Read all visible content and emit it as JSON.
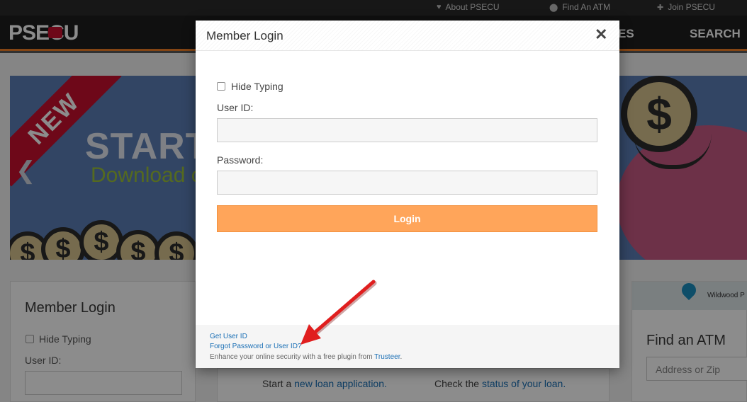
{
  "utility_bar": {
    "links": [
      {
        "label": "About PSECU",
        "icon": "heart-icon"
      },
      {
        "label": "Find An ATM",
        "icon": "map-marker-icon"
      },
      {
        "label": "Join PSECU",
        "icon": "add-user-icon"
      }
    ]
  },
  "main_nav": {
    "logo": "PSECU",
    "items": [
      "ES",
      "SEARCH"
    ]
  },
  "hero": {
    "ribbon": "NEW",
    "title": "START",
    "subtitle": "Download o",
    "coin_symbol": "$"
  },
  "bg_login_card": {
    "title": "Member Login",
    "hide_typing": "Hide Typing",
    "user_id_label": "User ID:"
  },
  "bg_loan_links": {
    "start_prefix": "Start a ",
    "start_link": "new loan application.",
    "check_prefix": "Check the ",
    "check_link": "status of your loan."
  },
  "bg_atm_card": {
    "title": "Find an ATM",
    "placeholder": "Address or Zip",
    "map_label": "Wildwood P"
  },
  "modal": {
    "title": "Member Login",
    "close_symbol": "✕",
    "hide_typing_label": "Hide Typing",
    "hide_typing_checked": false,
    "user_id_label": "User ID:",
    "user_id_value": "",
    "password_label": "Password:",
    "password_value": "",
    "login_button": "Login",
    "footer": {
      "get_user_id": "Get User ID",
      "forgot": "Forgot Password or User ID?",
      "enhance_prefix": "Enhance your online security with a free plugin from ",
      "trusteer": "Trusteer",
      "enhance_suffix": "."
    }
  },
  "colors": {
    "accent_orange": "#ffa55a",
    "brand_red": "#c8102e",
    "link_blue": "#1a6fb5",
    "annotation_red": "#e01e1e"
  }
}
